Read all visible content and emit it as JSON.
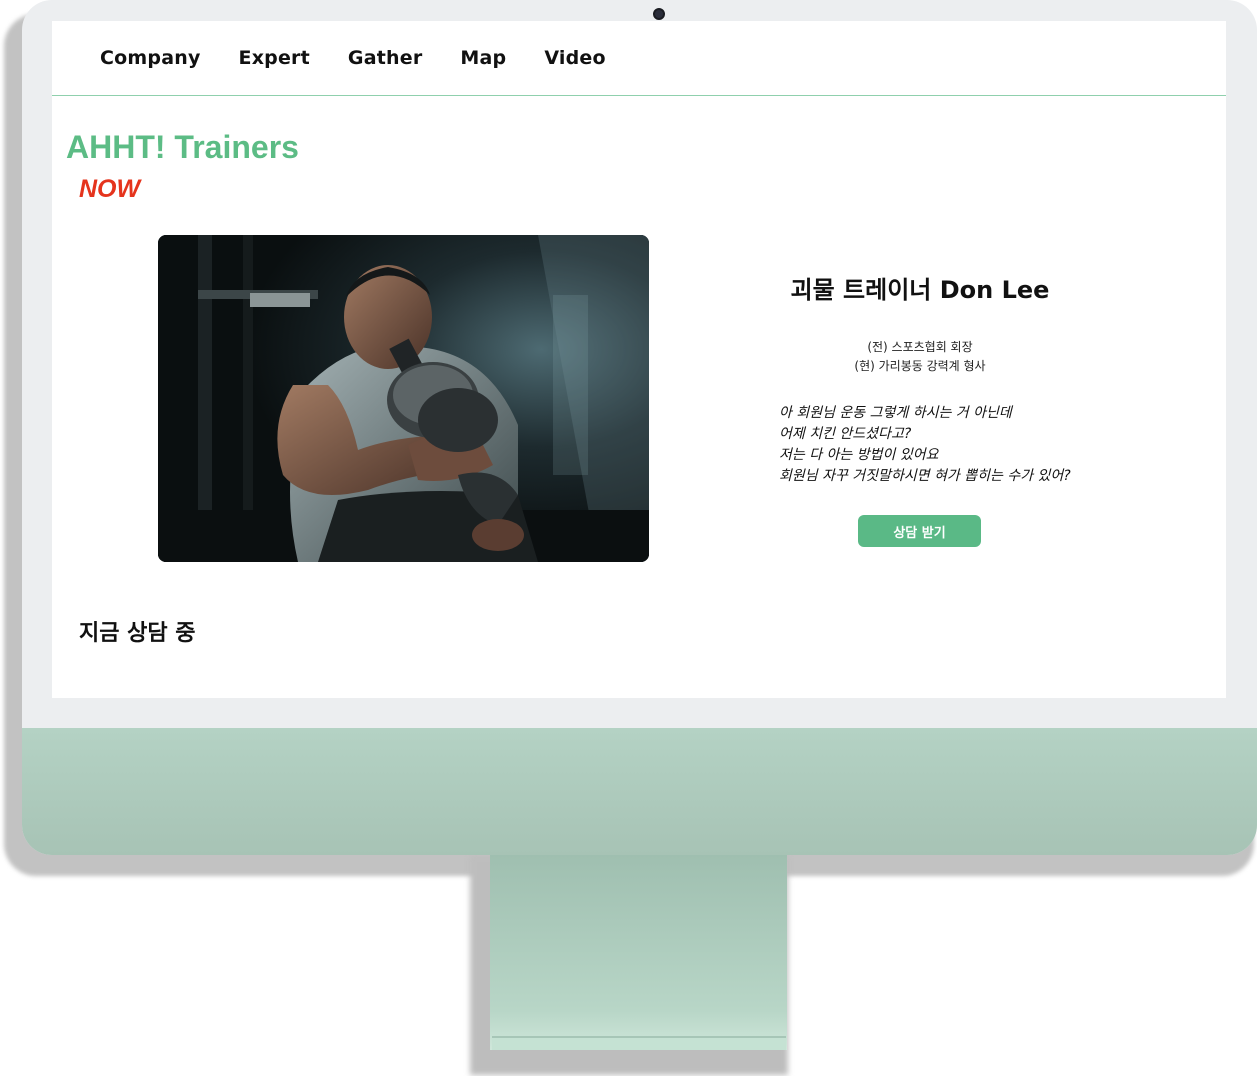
{
  "nav": {
    "items": [
      {
        "label": "Company"
      },
      {
        "label": "Expert"
      },
      {
        "label": "Gather"
      },
      {
        "label": "Map"
      },
      {
        "label": "Video"
      }
    ]
  },
  "hero": {
    "brand": "AHHT! Trainers",
    "badge": "NOW"
  },
  "trainer": {
    "photo_icon": "trainer-photo",
    "name": "괴물 트레이너 Don Lee",
    "credentials": [
      "(전) 스포츠협회 회장",
      "(현) 가리봉동 강력계 형사"
    ],
    "quote_lines": [
      "아 회원님 운동 그렇게 하시는 거 아닌데",
      "어제 치킨 안드셨다고?",
      "저는 다 아는 방법이 있어요",
      "회원님 자꾸 거짓말하시면 혀가 뽑히는 수가 있어?"
    ],
    "cta_label": "상담 받기"
  },
  "section": {
    "title": "지금 상담 중"
  },
  "colors": {
    "accent": "#5cbc85",
    "badge": "#e5341d",
    "button": "#5ab986",
    "monitor_chin": "#b4d2c4"
  }
}
